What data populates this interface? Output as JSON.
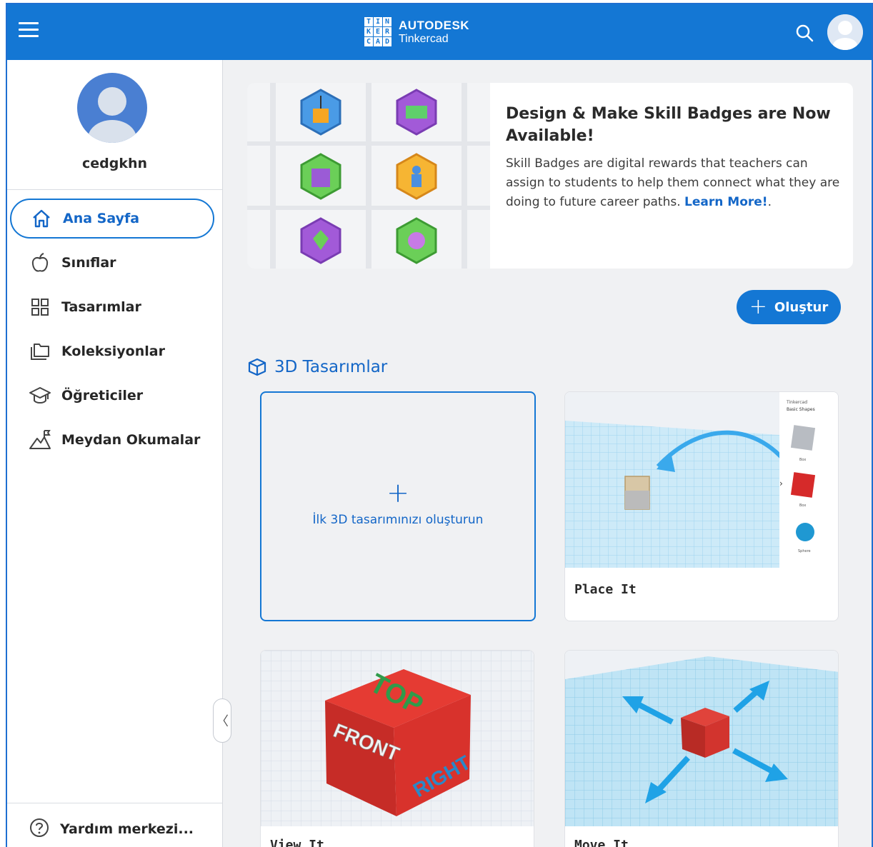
{
  "app": {
    "logo_letters": [
      "T",
      "I",
      "N",
      "K",
      "E",
      "R",
      "C",
      "A",
      "D"
    ],
    "brand": "AUTODESK",
    "product": "Tinkercad"
  },
  "sidebar": {
    "username": "cedgkhn",
    "items": [
      {
        "label": "Ana Sayfa",
        "icon": "home-icon"
      },
      {
        "label": "Sınıflar",
        "icon": "apple-icon"
      },
      {
        "label": "Tasarımlar",
        "icon": "grid-icon"
      },
      {
        "label": "Koleksiyonlar",
        "icon": "folder-icon"
      },
      {
        "label": "Öğreticiler",
        "icon": "graduation-cap-icon"
      },
      {
        "label": "Meydan Okumalar",
        "icon": "mountain-flag-icon"
      }
    ],
    "help": "Yardım merkezi..."
  },
  "banner": {
    "title": "Design & Make Skill Badges are Now Available!",
    "description": "Skill Badges are digital rewards that teachers can assign to students to help them connect what they are doing to future career paths.",
    "link": "Learn More!",
    "link_suffix": "."
  },
  "create_button": "Oluştur",
  "section": {
    "title": "3D Tasarımlar",
    "new_design": "İlk 3D tasarımınızı oluşturun",
    "cards": [
      {
        "label": "Place It"
      },
      {
        "label": "View It"
      },
      {
        "label": "Move It"
      }
    ],
    "place_it_panel": {
      "header": "Tinkercad",
      "subheader": "Basic Shapes",
      "shape1": "Box",
      "shape2": "Box",
      "shape3": "Sphere"
    },
    "view_it_faces": {
      "top": "TOP",
      "front": "FRONT",
      "right": "RIGHT"
    }
  },
  "colors": {
    "accent": "#1477d4",
    "link": "#1366c7",
    "background": "#f0f1f3"
  }
}
